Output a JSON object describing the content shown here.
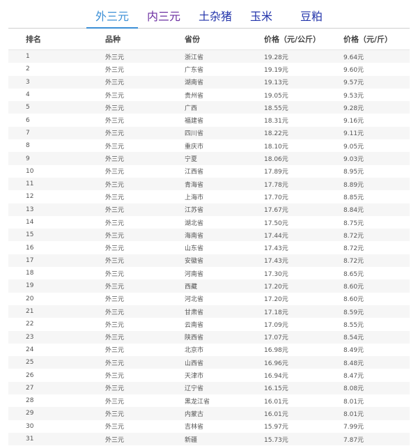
{
  "tabs": [
    {
      "label": "外三元",
      "active": true
    },
    {
      "label": "内三元",
      "active": false
    },
    {
      "label": "土杂猪",
      "active": false
    },
    {
      "label": "玉米",
      "active": false
    },
    {
      "label": "豆粕",
      "active": false
    }
  ],
  "table": {
    "headers": [
      "排名",
      "品种",
      "省份",
      "价格（元/公斤）",
      "价格（元/斤）"
    ],
    "rows": [
      [
        "1",
        "外三元",
        "浙江省",
        "19.28元",
        "9.64元"
      ],
      [
        "2",
        "外三元",
        "广东省",
        "19.19元",
        "9.60元"
      ],
      [
        "3",
        "外三元",
        "湖南省",
        "19.13元",
        "9.57元"
      ],
      [
        "4",
        "外三元",
        "贵州省",
        "19.05元",
        "9.53元"
      ],
      [
        "5",
        "外三元",
        "广西",
        "18.55元",
        "9.28元"
      ],
      [
        "6",
        "外三元",
        "福建省",
        "18.31元",
        "9.16元"
      ],
      [
        "7",
        "外三元",
        "四川省",
        "18.22元",
        "9.11元"
      ],
      [
        "8",
        "外三元",
        "重庆市",
        "18.10元",
        "9.05元"
      ],
      [
        "9",
        "外三元",
        "宁夏",
        "18.06元",
        "9.03元"
      ],
      [
        "10",
        "外三元",
        "江西省",
        "17.89元",
        "8.95元"
      ],
      [
        "11",
        "外三元",
        "青海省",
        "17.78元",
        "8.89元"
      ],
      [
        "12",
        "外三元",
        "上海市",
        "17.70元",
        "8.85元"
      ],
      [
        "13",
        "外三元",
        "江苏省",
        "17.67元",
        "8.84元"
      ],
      [
        "14",
        "外三元",
        "湖北省",
        "17.50元",
        "8.75元"
      ],
      [
        "15",
        "外三元",
        "海南省",
        "17.44元",
        "8.72元"
      ],
      [
        "16",
        "外三元",
        "山东省",
        "17.43元",
        "8.72元"
      ],
      [
        "17",
        "外三元",
        "安徽省",
        "17.43元",
        "8.72元"
      ],
      [
        "18",
        "外三元",
        "河南省",
        "17.30元",
        "8.65元"
      ],
      [
        "19",
        "外三元",
        "西藏",
        "17.20元",
        "8.60元"
      ],
      [
        "20",
        "外三元",
        "河北省",
        "17.20元",
        "8.60元"
      ],
      [
        "21",
        "外三元",
        "甘肃省",
        "17.18元",
        "8.59元"
      ],
      [
        "22",
        "外三元",
        "云南省",
        "17.09元",
        "8.55元"
      ],
      [
        "23",
        "外三元",
        "陕西省",
        "17.07元",
        "8.54元"
      ],
      [
        "24",
        "外三元",
        "北京市",
        "16.98元",
        "8.49元"
      ],
      [
        "25",
        "外三元",
        "山西省",
        "16.96元",
        "8.48元"
      ],
      [
        "26",
        "外三元",
        "天津市",
        "16.94元",
        "8.47元"
      ],
      [
        "27",
        "外三元",
        "辽宁省",
        "16.15元",
        "8.08元"
      ],
      [
        "28",
        "外三元",
        "黑龙江省",
        "16.01元",
        "8.01元"
      ],
      [
        "29",
        "外三元",
        "内蒙古",
        "16.01元",
        "8.01元"
      ],
      [
        "30",
        "外三元",
        "吉林省",
        "15.97元",
        "7.99元"
      ],
      [
        "31",
        "外三元",
        "新疆",
        "15.73元",
        "7.87元"
      ]
    ]
  }
}
